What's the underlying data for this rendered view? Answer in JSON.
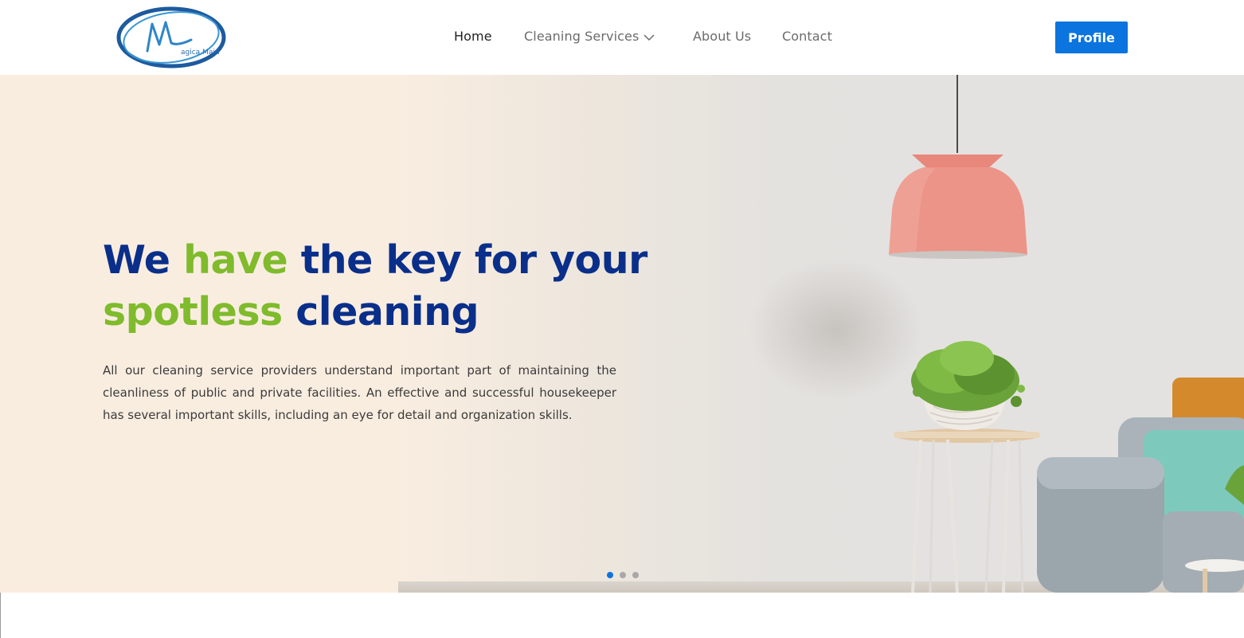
{
  "header": {
    "logo_text": "agica Maid",
    "nav": {
      "home": "Home",
      "services": "Cleaning Services",
      "about": "About Us",
      "contact": "Contact"
    },
    "profile_button": "Profile"
  },
  "hero": {
    "headline": {
      "line1_part1": "We",
      "line1_green": "have",
      "line1_part2": "the key for your",
      "line2_green": "spotless",
      "line2_part2": "cleaning"
    },
    "description": "All our cleaning service providers understand important part of maintaining the cleanliness of public and private facilities. An effective and successful housekeeper has several important skills, including an eye for detail and organization skills.",
    "carousel": {
      "slide_count": 3,
      "active_index": 0
    }
  },
  "colors": {
    "brand_blue": "#0a2f8a",
    "accent_green": "#7fbb2c",
    "button_blue": "#0b74de",
    "hero_cream": "#f9ede0"
  },
  "icons": {
    "services_dropdown": "chevron-down-icon"
  }
}
